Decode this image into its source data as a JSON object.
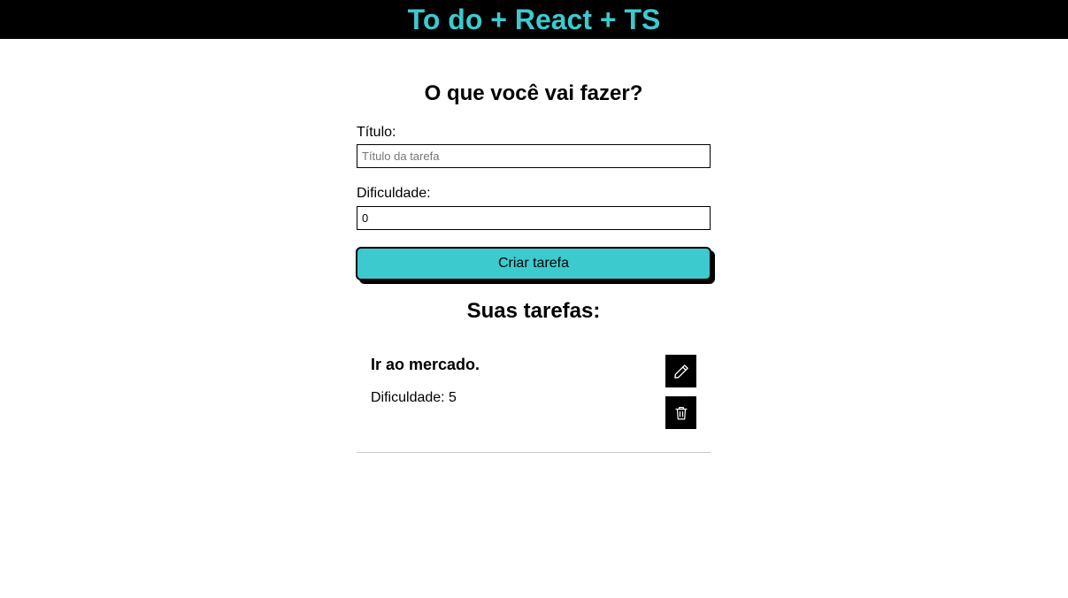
{
  "header": {
    "title": "To do + React + TS"
  },
  "form": {
    "heading": "O que você vai fazer?",
    "title_label": "Título:",
    "title_placeholder": "Título da tarefa",
    "title_value": "",
    "difficulty_label": "Dificuldade:",
    "difficulty_value": "0",
    "submit_label": "Criar tarefa"
  },
  "list": {
    "heading": "Suas tarefas:",
    "tasks": [
      {
        "title": "Ir ao mercado.",
        "difficulty_text": "Dificuldade: 5",
        "edit_icon": "pencil-icon",
        "delete_icon": "trash-icon"
      }
    ]
  },
  "colors": {
    "accent": "#3ccacf",
    "header_bg": "#000000",
    "divider": "#c8c8c8"
  }
}
